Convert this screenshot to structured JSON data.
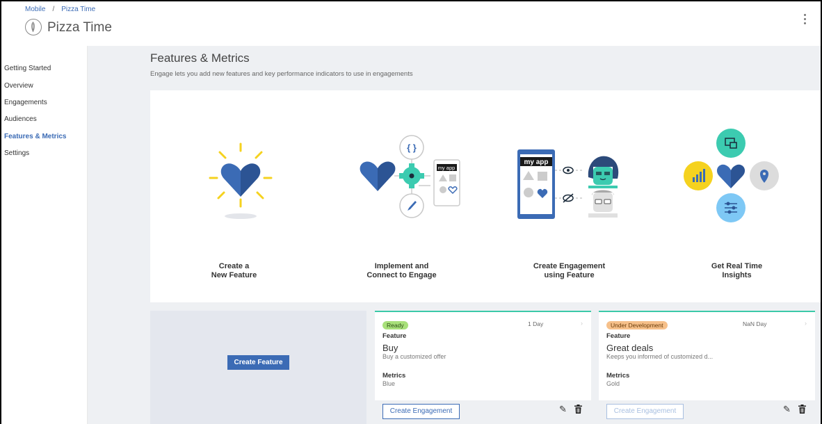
{
  "breadcrumb": {
    "root": "Mobile",
    "separator": "/",
    "current": "Pizza Time"
  },
  "header": {
    "title": "Pizza Time",
    "logo_icon": "feather-icon",
    "menu_icon": "kebab-menu-icon"
  },
  "sidebar": {
    "items": [
      {
        "label": "Getting Started",
        "active": false
      },
      {
        "label": "Overview",
        "active": false
      },
      {
        "label": "Engagements",
        "active": false
      },
      {
        "label": "Audiences",
        "active": false
      },
      {
        "label": "Features & Metrics",
        "active": true
      },
      {
        "label": "Settings",
        "active": false
      }
    ]
  },
  "page": {
    "title": "Features & Metrics",
    "subtitle": "Engage lets you add new features and key performance indicators to use in engagements"
  },
  "steps": [
    {
      "line1": "Create a",
      "line2": "New Feature"
    },
    {
      "line1": "Implement and",
      "line2": "Connect to Engage",
      "app_label": "my app"
    },
    {
      "line1": "Create Engagement",
      "line2": "using Feature",
      "app_label": "my app"
    },
    {
      "line1": "Get Real Time",
      "line2": "Insights"
    }
  ],
  "create_card": {
    "button": "Create Feature"
  },
  "cards": [
    {
      "status": "Ready",
      "age": "1 Day",
      "feature_label": "Feature",
      "name": "Buy",
      "description": "Buy a customized offer",
      "metrics_label": "Metrics",
      "metrics_value": "Blue",
      "button": "Create Engagement",
      "button_enabled": true
    },
    {
      "status": "Under Development",
      "age": "NaN Day",
      "feature_label": "Feature",
      "name": "Great deals",
      "description": "Keeps you informed of customized d...",
      "metrics_label": "Metrics",
      "metrics_value": "Gold",
      "button": "Create Engagement",
      "button_enabled": false
    }
  ],
  "colors": {
    "accent": "#3b6bb5",
    "card_border": "#3bc9a8",
    "ready": "#a8e07a",
    "dev": "#f6c08a"
  }
}
